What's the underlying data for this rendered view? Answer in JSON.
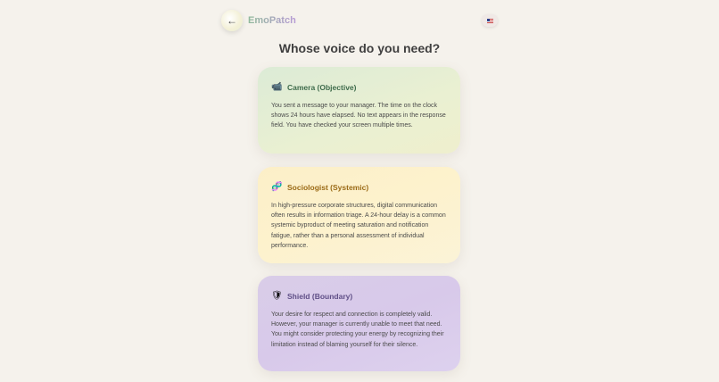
{
  "header": {
    "back_icon": "arrow-left-icon",
    "back_glyph": "←",
    "brand": "EmoPatch",
    "language_icon": "us-flag-icon"
  },
  "title": "Whose voice do you need?",
  "cards": [
    {
      "icon": "camera-icon",
      "glyph": "📹",
      "title": "Camera (Objective)",
      "body": "You sent a message to your manager. The time on the clock shows 24 hours have elapsed. No text appears in the response field. You have checked your screen multiple times."
    },
    {
      "icon": "dna-icon",
      "glyph": "🧬",
      "title": "Sociologist (Systemic)",
      "body": "In high-pressure corporate structures, digital communication often results in information triage. A 24-hour delay is a common systemic byproduct of meeting saturation and notification fatigue, rather than a personal assessment of individual performance."
    },
    {
      "icon": "shield-icon",
      "glyph": "🛡",
      "title": "Shield (Boundary)",
      "body": "Your desire for respect and connection is completely valid. However, your manager is currently unable to meet that need. You might consider protecting your energy by recognizing their limitation instead of blaming yourself for their silence."
    }
  ],
  "colors": {
    "background": "#f5f2ec",
    "camera_card": "#e3eed4",
    "sociologist_card": "#fcf0cb",
    "shield_card": "#d9cbea"
  }
}
